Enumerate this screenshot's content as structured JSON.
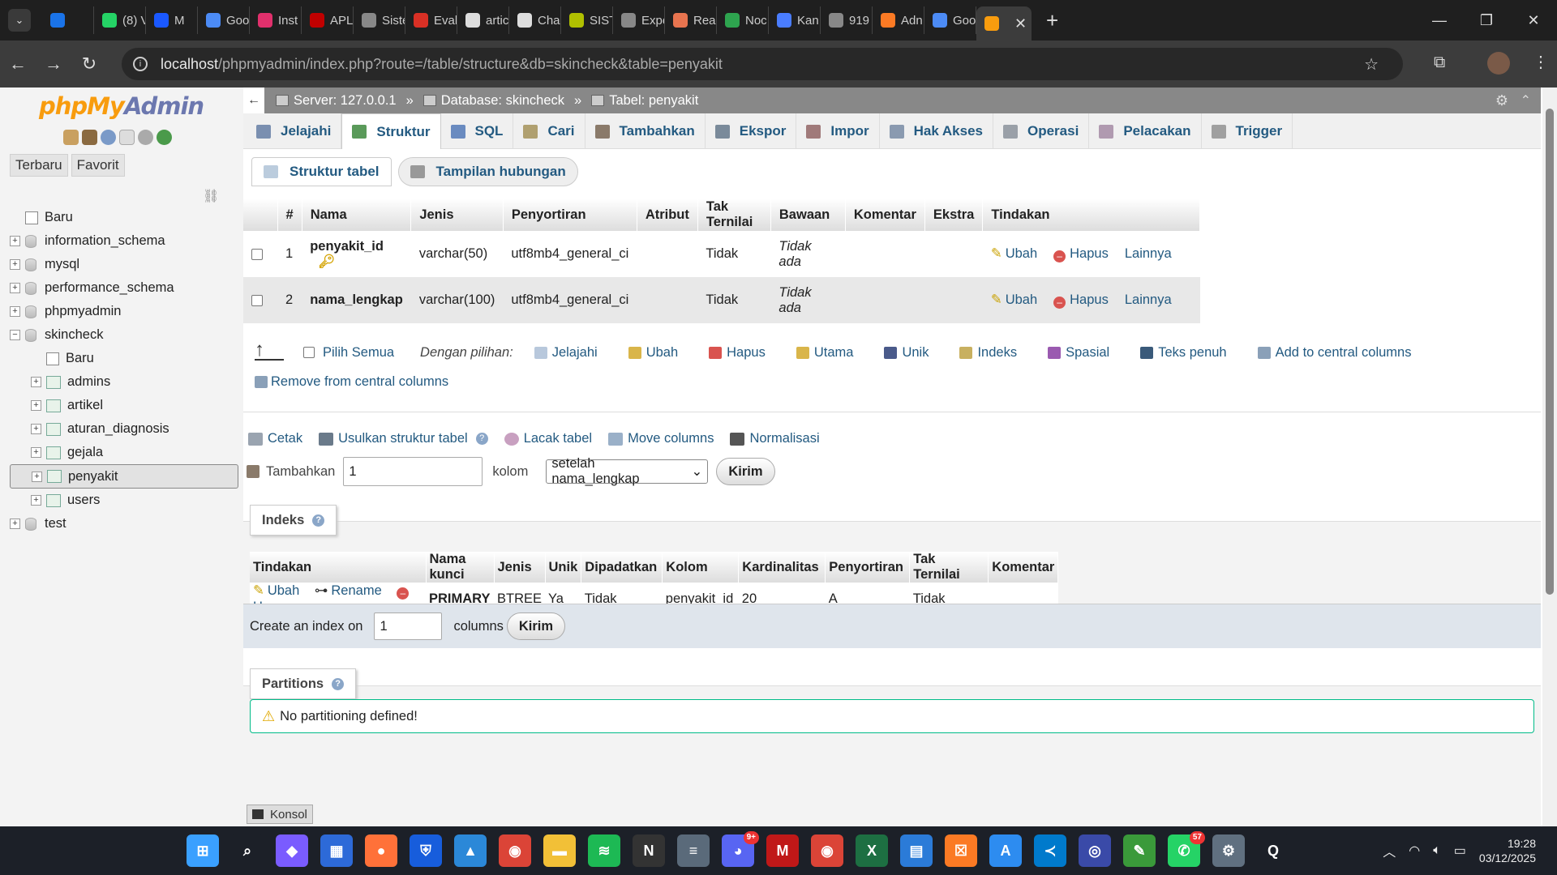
{
  "browser": {
    "tabs": [
      {
        "label": "",
        "color": "#1a73e8",
        "icon": "google-drive-icon"
      },
      {
        "label": "(8) V",
        "color": "#25d366",
        "icon": "whatsapp-icon"
      },
      {
        "label": "M",
        "color": "#1a58ff",
        "icon": "meta-icon"
      },
      {
        "label": "Goo",
        "color": "#4c8bf5",
        "icon": "gemini-icon"
      },
      {
        "label": "Inst",
        "color": "#e1306c",
        "icon": "instagram-icon"
      },
      {
        "label": "APL",
        "color": "#c00000",
        "icon": "anz-icon"
      },
      {
        "label": "Siste",
        "color": "#888888",
        "icon": "globe-icon"
      },
      {
        "label": "Eval",
        "color": "#d93025",
        "icon": "eval-icon"
      },
      {
        "label": "artic",
        "color": "#dddddd",
        "icon": "doc-icon"
      },
      {
        "label": "Cha",
        "color": "#dddddd",
        "icon": "chatgpt-icon"
      },
      {
        "label": "SIST",
        "color": "#b0c000",
        "icon": "sist-icon"
      },
      {
        "label": "Expe",
        "color": "#888888",
        "icon": "globe-icon"
      },
      {
        "label": "Rea",
        "color": "#e8744f",
        "icon": "claude-icon"
      },
      {
        "label": "Noc",
        "color": "#2ea44f",
        "icon": "noc-icon"
      },
      {
        "label": "Kan",
        "color": "#4a7dff",
        "icon": "kanban-icon"
      },
      {
        "label": "919",
        "color": "#888888",
        "icon": "globe-icon"
      },
      {
        "label": "Adn",
        "color": "#fb7a24",
        "icon": "xampp-icon"
      },
      {
        "label": "Goo",
        "color": "#4c8bf5",
        "icon": "gemini-icon"
      }
    ],
    "active_tab": {
      "label": "",
      "icon": "phpmyadmin-icon"
    },
    "url_host": "localhost",
    "url_path": "/phpmyadmin/index.php?route=/table/structure&db=skincheck&table=penyakit"
  },
  "sidebar": {
    "logo_php": "php",
    "logo_my": "My",
    "logo_admin": "Admin",
    "tabs": [
      "Terbaru",
      "Favorit"
    ],
    "tree": [
      {
        "label": "Baru",
        "kind": "new",
        "level": 0
      },
      {
        "label": "information_schema",
        "kind": "db",
        "level": 0
      },
      {
        "label": "mysql",
        "kind": "db",
        "level": 0
      },
      {
        "label": "performance_schema",
        "kind": "db",
        "level": 0
      },
      {
        "label": "phpmyadmin",
        "kind": "db",
        "level": 0
      },
      {
        "label": "skincheck",
        "kind": "db-open",
        "level": 0
      },
      {
        "label": "Baru",
        "kind": "new",
        "level": 1
      },
      {
        "label": "admins",
        "kind": "table",
        "level": 1
      },
      {
        "label": "artikel",
        "kind": "table",
        "level": 1
      },
      {
        "label": "aturan_diagnosis",
        "kind": "table",
        "level": 1
      },
      {
        "label": "gejala",
        "kind": "table",
        "level": 1
      },
      {
        "label": "penyakit",
        "kind": "table",
        "level": 1,
        "selected": true
      },
      {
        "label": "users",
        "kind": "table",
        "level": 1
      },
      {
        "label": "test",
        "kind": "db",
        "level": 0
      }
    ]
  },
  "breadcrumb": {
    "server": "Server: 127.0.0.1",
    "database": "Database: skincheck",
    "table": "Tabel: penyakit",
    "sep": "»"
  },
  "toptabs": [
    {
      "label": "Jelajahi",
      "color": "#7a8fb0"
    },
    {
      "label": "Struktur",
      "color": "#5a9a5a",
      "active": true
    },
    {
      "label": "SQL",
      "color": "#6a8bc0"
    },
    {
      "label": "Cari",
      "color": "#b0a070"
    },
    {
      "label": "Tambahkan",
      "color": "#8a7a6a"
    },
    {
      "label": "Ekspor",
      "color": "#7a8a9a"
    },
    {
      "label": "Impor",
      "color": "#a07a7a"
    },
    {
      "label": "Hak Akses",
      "color": "#8a9ab0"
    },
    {
      "label": "Operasi",
      "color": "#9aa0a8"
    },
    {
      "label": "Pelacakan",
      "color": "#b09ab0"
    },
    {
      "label": "Trigger",
      "color": "#a0a0a0"
    }
  ],
  "subtabs": {
    "structure": "Struktur tabel",
    "relation": "Tampilan hubungan"
  },
  "structure": {
    "headers": [
      "#",
      "Nama",
      "Jenis",
      "Penyortiran",
      "Atribut",
      "Tak Ternilai",
      "Bawaan",
      "Komentar",
      "Ekstra",
      "Tindakan"
    ],
    "rows": [
      {
        "num": "1",
        "name": "penyakit_id",
        "type": "varchar(50)",
        "collation": "utf8mb4_general_ci",
        "attr": "",
        "null": "Tidak",
        "default": "Tidak ada",
        "comment": "",
        "extra": "",
        "primary": true
      },
      {
        "num": "2",
        "name": "nama_lengkap",
        "type": "varchar(100)",
        "collation": "utf8mb4_general_ci",
        "attr": "",
        "null": "Tidak",
        "default": "Tidak ada",
        "comment": "",
        "extra": "",
        "primary": false
      }
    ],
    "actions": {
      "edit": "Ubah",
      "delete": "Hapus",
      "more": "Lainnya"
    }
  },
  "bulk": {
    "select_all": "Pilih Semua",
    "with_selected": "Dengan pilihan:",
    "items": [
      {
        "label": "Jelajahi",
        "color": "#b8c8dc"
      },
      {
        "label": "Ubah",
        "color": "#d9b54a"
      },
      {
        "label": "Hapus",
        "color": "#d9534f"
      },
      {
        "label": "Utama",
        "color": "#d9b54a"
      },
      {
        "label": "Unik",
        "color": "#4a5a8a"
      },
      {
        "label": "Indeks",
        "color": "#c8b060"
      },
      {
        "label": "Spasial",
        "color": "#9a5ab0"
      },
      {
        "label": "Teks penuh",
        "color": "#3a5a7a"
      },
      {
        "label": "Add to central columns",
        "color": "#8aa0b8"
      }
    ],
    "remove_central": "Remove from central columns"
  },
  "actions_bar": {
    "print": "Cetak",
    "propose": "Usulkan struktur tabel",
    "track": "Lacak tabel",
    "move": "Move columns",
    "normalize": "Normalisasi",
    "help": "?"
  },
  "add_columns": {
    "label": "Tambahkan",
    "value": "1",
    "kolom": "kolom",
    "position": "setelah nama_lengkap",
    "submit": "Kirim"
  },
  "indexes": {
    "legend": "Indeks",
    "headers": [
      "Tindakan",
      "Nama kunci",
      "Jenis",
      "Unik",
      "Dipadatkan",
      "Kolom",
      "Kardinalitas",
      "Penyortiran",
      "Tak Ternilai",
      "Komentar"
    ],
    "row": {
      "edit": "Ubah",
      "rename": "Rename",
      "delete": "Hapus",
      "key": "PRIMARY",
      "type": "BTREE",
      "unique": "Ya",
      "packed": "Tidak",
      "column": "penyakit_id",
      "cardinality": "20",
      "collation": "A",
      "null": "Tidak",
      "comment": ""
    }
  },
  "create_index": {
    "label": "Create an index on",
    "value": "1",
    "columns": "columns",
    "submit": "Kirim"
  },
  "partitions": {
    "legend": "Partitions",
    "message": "No partitioning defined!"
  },
  "console": {
    "label": "Konsol"
  },
  "taskbar": {
    "apps": [
      {
        "name": "start-icon",
        "color": "#3aa0ff",
        "glyph": "⊞"
      },
      {
        "name": "search-icon",
        "color": "#1c2028",
        "glyph": "⌕"
      },
      {
        "name": "copilot-icon",
        "color": "#7a5cff",
        "glyph": "◆"
      },
      {
        "name": "store-icon",
        "color": "#2d6ad8",
        "glyph": "▦"
      },
      {
        "name": "firefox-icon",
        "color": "#ff7139",
        "glyph": "●"
      },
      {
        "name": "bitwarden-icon",
        "color": "#175ddc",
        "glyph": "⛨"
      },
      {
        "name": "photos-icon",
        "color": "#2b88d8",
        "glyph": "▲"
      },
      {
        "name": "chrome-icon",
        "color": "#db4437",
        "glyph": "◉"
      },
      {
        "name": "explorer-icon",
        "color": "#f2c037",
        "glyph": "▬"
      },
      {
        "name": "spotify-icon",
        "color": "#1db954",
        "glyph": "≋"
      },
      {
        "name": "notion-icon",
        "color": "#333333",
        "glyph": "N"
      },
      {
        "name": "db-icon",
        "color": "#5a6a7a",
        "glyph": "≡"
      },
      {
        "name": "discord-icon",
        "color": "#5865f2",
        "glyph": "◕",
        "badge": "9+"
      },
      {
        "name": "mcafee-icon",
        "color": "#c01818",
        "glyph": "M"
      },
      {
        "name": "chrome-icon",
        "color": "#db4437",
        "glyph": "◉"
      },
      {
        "name": "excel-icon",
        "color": "#1d6f42",
        "glyph": "X"
      },
      {
        "name": "notepad-icon",
        "color": "#2b7bd8",
        "glyph": "▤"
      },
      {
        "name": "xampp-icon",
        "color": "#fb7a24",
        "glyph": "☒"
      },
      {
        "name": "appstore-icon",
        "color": "#2d8cf0",
        "glyph": "A"
      },
      {
        "name": "vscode-icon",
        "color": "#007acc",
        "glyph": "≺"
      },
      {
        "name": "app-icon",
        "color": "#3a4aa8",
        "glyph": "◎"
      },
      {
        "name": "cheatsheet-icon",
        "color": "#3a9a3a",
        "glyph": "✎"
      },
      {
        "name": "whatsapp-icon",
        "color": "#25d366",
        "glyph": "✆",
        "badge": "57"
      },
      {
        "name": "settings-icon",
        "color": "#607080",
        "glyph": "⚙"
      },
      {
        "name": "qlik-icon",
        "color": "#1c2028",
        "glyph": "Q"
      }
    ],
    "time": "19:28",
    "date": "03/12/2025"
  }
}
